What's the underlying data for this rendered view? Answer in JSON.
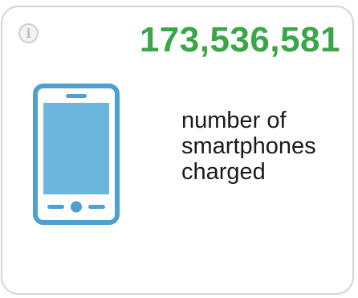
{
  "widget": {
    "info_icon": {
      "glyph": "i",
      "icon": "info-icon"
    },
    "value": "173,536,581",
    "caption_lines": [
      "number of",
      "smartphones",
      "charged"
    ],
    "icon": "smartphone-icon"
  },
  "colors": {
    "accent_green": "#3aa648",
    "phone_blue": "#4f9fcf",
    "screen_blue": "#6bb6dc",
    "border_grey": "#d4d4d4"
  }
}
